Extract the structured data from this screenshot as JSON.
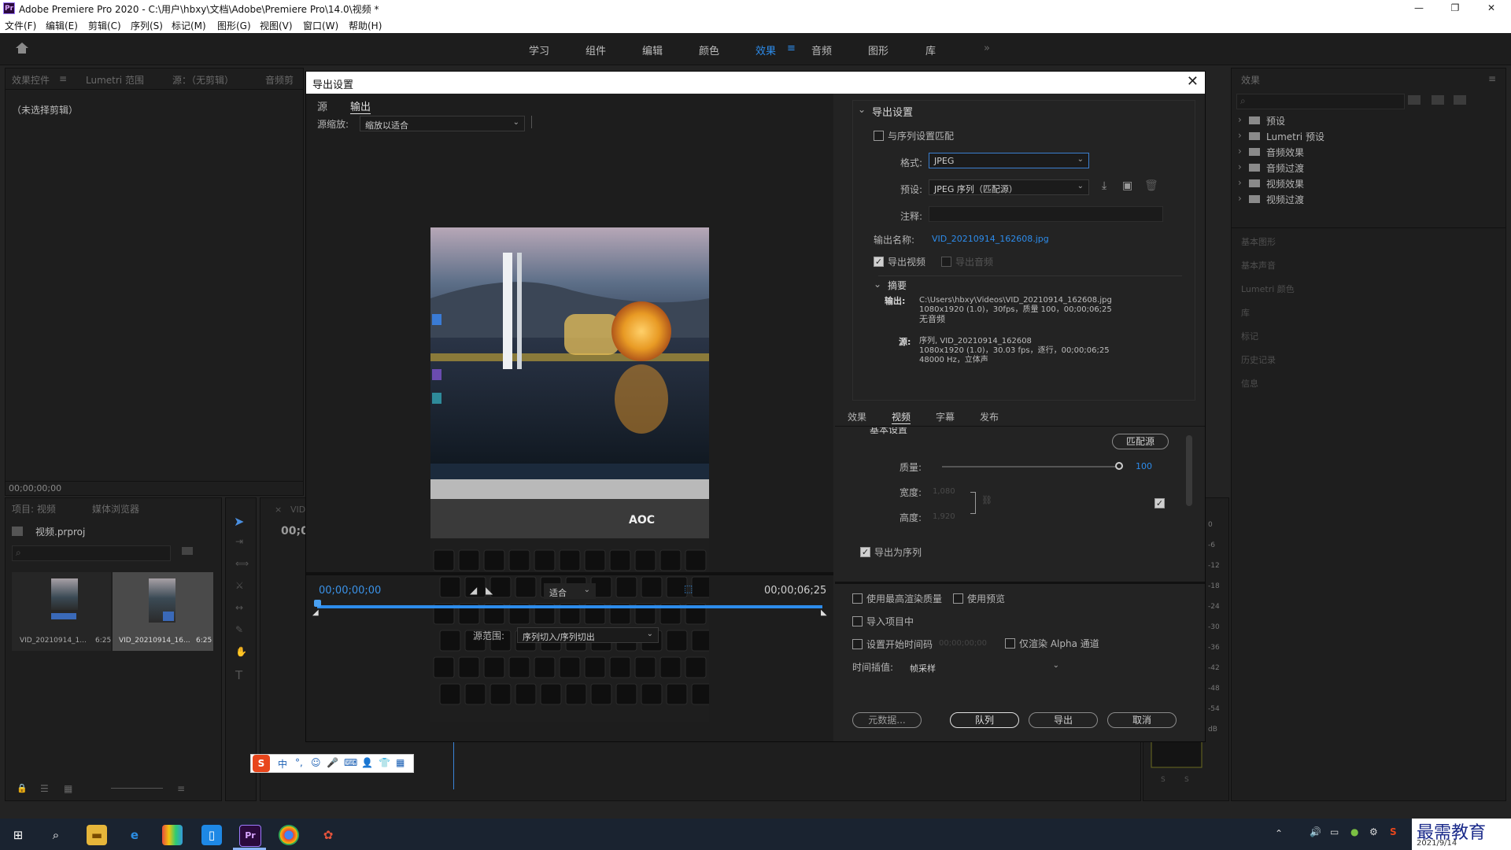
{
  "window": {
    "title": "Adobe Premiere Pro 2020 - C:\\用户\\hbxy\\文档\\Adobe\\Premiere Pro\\14.0\\视频 *",
    "app_badge": "Pr"
  },
  "menu": [
    "文件(F)",
    "编辑(E)",
    "剪辑(C)",
    "序列(S)",
    "标记(M)",
    "图形(G)",
    "视图(V)",
    "窗口(W)",
    "帮助(H)"
  ],
  "workspaces": [
    "学习",
    "组件",
    "编辑",
    "颜色",
    "效果",
    "音频",
    "图形",
    "库"
  ],
  "workspace_active": "效果",
  "left_top_panel": {
    "tabs": [
      "效果控件",
      "Lumetri 范围",
      "源：（无剪辑）",
      "音频剪"
    ],
    "no_clip": "（未选择剪辑）",
    "timecode": "00;00;00;00"
  },
  "project_panel": {
    "tabs": [
      "项目: 视频",
      "媒体浏览器"
    ],
    "project_name": "视频.prproj",
    "items": [
      {
        "name": "VID_20210914_1...",
        "duration": "6:25"
      },
      {
        "name": "VID_20210914_16...",
        "duration": "6:25"
      }
    ]
  },
  "timeline_stub": {
    "tab": "VID",
    "timecode": "00;0"
  },
  "effects_panel": {
    "title": "效果",
    "tree": [
      "预设",
      "Lumetri 预设",
      "音频效果",
      "音频过渡",
      "视频效果",
      "视频过渡"
    ],
    "collapsed": [
      "基本图形",
      "基本声音",
      "Lumetri 颜色",
      "库",
      "标记",
      "历史记录",
      "信息"
    ]
  },
  "audio_meter": {
    "ticks": [
      "0",
      "-6",
      "-12",
      "-18",
      "-24",
      "-30",
      "-36",
      "-42",
      "-48",
      "-54",
      "dB"
    ],
    "buttons": [
      "S",
      "S"
    ]
  },
  "dialog": {
    "title": "导出设置",
    "left_tabs": [
      "源",
      "输出"
    ],
    "left_tab_active": "输出",
    "source_scaling_label": "源缩放:",
    "source_scaling_value": "缩放以适合",
    "monitor_brand": "AOC",
    "timecode_in": "00;00;00;00",
    "fit_value": "适合",
    "timecode_out": "00;00;06;25",
    "source_range_label": "源范围:",
    "source_range_value": "序列切入/序列切出",
    "export_settings": {
      "header": "导出设置",
      "match_sequence": "与序列设置匹配",
      "format_label": "格式:",
      "format_value": "JPEG",
      "preset_label": "预设:",
      "preset_value": "JPEG 序列（匹配源）",
      "comments_label": "注释:",
      "output_name_label": "输出名称:",
      "output_name_value": "VID_20210914_162608.jpg",
      "export_video": "导出视频",
      "export_audio": "导出音频",
      "summary_header": "摘要",
      "output_label": "输出:",
      "output_lines": [
        "C:\\Users\\hbxy\\Videos\\VID_20210914_162608.jpg",
        "1080x1920 (1.0)，30fps，质量 100，00;00;06;25",
        "无音频"
      ],
      "source_label": "源:",
      "source_lines": [
        "序列, VID_20210914_162608",
        "1080x1920 (1.0)，30.03 fps，逐行，00;00;06;25",
        "48000 Hz，立体声"
      ]
    },
    "settings_tabs": [
      "效果",
      "视频",
      "字幕",
      "发布"
    ],
    "settings_tab_active": "视频",
    "video": {
      "section_partial": "基本设置",
      "match_source_btn": "匹配源",
      "quality_label": "质量:",
      "quality_value": 100,
      "width_label": "宽度:",
      "width_value": "1,080",
      "height_label": "高度:",
      "height_value": "1,920",
      "export_as_sequence": "导出为序列"
    },
    "bottom": {
      "max_render": "使用最高渲染质量",
      "use_previews": "使用预览",
      "import_into_project": "导入项目中",
      "set_start_tc": "设置开始时间码",
      "start_tc_value": "00;00;00;00",
      "render_alpha": "仅渲染 Alpha 通道",
      "time_interp_label": "时间插值:",
      "time_interp_value": "帧采样",
      "btn_metadata": "元数据...",
      "btn_queue": "队列",
      "btn_export": "导出",
      "btn_cancel": "取消"
    }
  },
  "ime_toolbar": {
    "logo": "S",
    "items": [
      "中",
      "°,",
      "☺",
      "🎤",
      "⌨",
      "👤",
      "👕",
      "▦"
    ]
  },
  "taskbar": {
    "date": "2021/9/14",
    "watermark": "最需教育",
    "tray": [
      "^",
      "🔊",
      "⊡",
      "●",
      "⚙",
      "S"
    ]
  },
  "colors": {
    "accent": "#2d8ceb",
    "bg": "#232323",
    "panel": "#1e1e1e"
  }
}
